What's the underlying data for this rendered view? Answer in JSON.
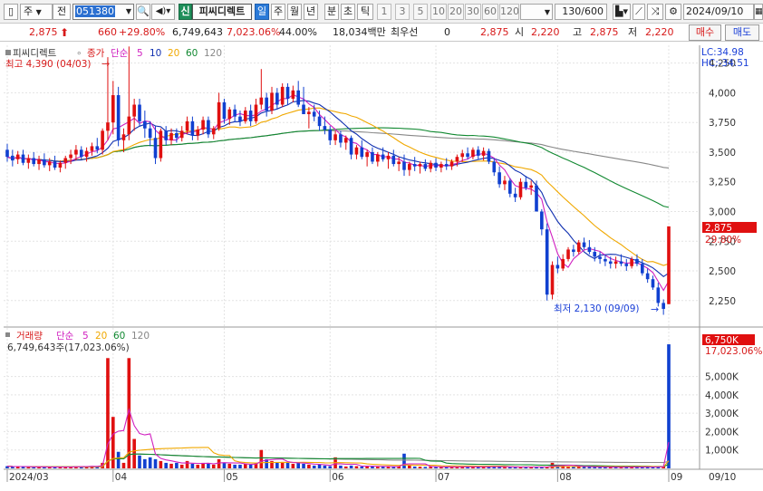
{
  "toolbar": {
    "market": "주",
    "jeon": "전",
    "code": "051380",
    "new_label": "신",
    "stock_name": "피씨디렉트",
    "periods": [
      "일",
      "주",
      "월",
      "년",
      "분",
      "초",
      "틱"
    ],
    "selected_period": "일",
    "intervals": [
      "1",
      "3",
      "5",
      "10",
      "20",
      "30",
      "60",
      "120"
    ],
    "count": "130/600",
    "date": "2024/09/10"
  },
  "quote": {
    "price": "2,875",
    "change": "660",
    "change_pct": "+29.80%",
    "volume": "6,749,643",
    "volume_ratio": "7,023.06%",
    "turnover": "44.00%",
    "amount": "18,034백만",
    "prefer_label": "최우선",
    "prefer_value": "0",
    "last": "2,875",
    "open_label": "시",
    "open": "2,220",
    "high_label": "고",
    "high": "2,875",
    "low_label": "저",
    "low": "2,220",
    "buy_label": "매수",
    "sell_label": "매도"
  },
  "price_panel": {
    "legend_name": "피씨디렉트",
    "legend_close": "종가",
    "legend_ma": "단순",
    "ma_periods": [
      "5",
      "10",
      "20",
      "60",
      "120"
    ],
    "lc_label": "LC:34.98",
    "hc_label": "HC:-34.51",
    "high_annotation": "최고 4,390 (04/03)",
    "low_annotation": "최저 2,130 (09/09)",
    "current_tag": "2,875",
    "pct_tag": "29.80%"
  },
  "volume_panel": {
    "legend_name": "거래량",
    "legend_ma": "단순",
    "ma_periods": [
      "5",
      "20",
      "60",
      "120"
    ],
    "volume_text": "6,749,643주(17,023.06%)",
    "current_tag": "6,750K",
    "pct_tag": "17,023.06%"
  },
  "colors": {
    "up": "#e01010",
    "down": "#1040d0",
    "ma5": "#d020c0",
    "ma10": "#1030b0",
    "ma20": "#f0a800",
    "ma60": "#108830",
    "ma120": "#888888"
  },
  "chart_data": [
    {
      "type": "candlestick",
      "ylim": [
        2050,
        4400
      ],
      "yticks": [
        2250,
        2500,
        2750,
        3000,
        3250,
        3500,
        3750,
        4000,
        4250
      ],
      "ytick_labels": [
        "2,250",
        "2,500",
        "2,750",
        "3,000",
        "3,250",
        "3,500",
        "3,750",
        "4,000",
        "4,250"
      ],
      "xlabels": [
        {
          "i": 0,
          "label": "2024/03"
        },
        {
          "i": 20,
          "label": "04"
        },
        {
          "i": 41,
          "label": "05"
        },
        {
          "i": 61,
          "label": "06"
        },
        {
          "i": 81,
          "label": "07"
        },
        {
          "i": 104,
          "label": "08"
        },
        {
          "i": 125,
          "label": "09"
        },
        {
          "i": 138,
          "label": "09/10"
        }
      ],
      "ohlc": [
        [
          3520,
          3570,
          3420,
          3460
        ],
        [
          3470,
          3520,
          3380,
          3430
        ],
        [
          3440,
          3510,
          3400,
          3480
        ],
        [
          3480,
          3520,
          3390,
          3410
        ],
        [
          3410,
          3480,
          3360,
          3450
        ],
        [
          3450,
          3500,
          3380,
          3400
        ],
        [
          3400,
          3470,
          3350,
          3440
        ],
        [
          3440,
          3490,
          3370,
          3390
        ],
        [
          3390,
          3450,
          3340,
          3420
        ],
        [
          3420,
          3470,
          3350,
          3370
        ],
        [
          3370,
          3430,
          3330,
          3410
        ],
        [
          3410,
          3470,
          3360,
          3450
        ],
        [
          3450,
          3520,
          3400,
          3480
        ],
        [
          3480,
          3560,
          3430,
          3520
        ],
        [
          3520,
          3550,
          3440,
          3460
        ],
        [
          3460,
          3540,
          3420,
          3510
        ],
        [
          3510,
          3580,
          3470,
          3550
        ],
        [
          3550,
          3620,
          3490,
          3520
        ],
        [
          3520,
          3700,
          3480,
          3680
        ],
        [
          3680,
          4300,
          3600,
          3750
        ],
        [
          3750,
          4100,
          3650,
          3980
        ],
        [
          3980,
          4050,
          3550,
          3600
        ],
        [
          3600,
          3700,
          3500,
          3650
        ],
        [
          3650,
          4390,
          3600,
          3800
        ],
        [
          3800,
          3950,
          3680,
          3900
        ],
        [
          3900,
          3950,
          3720,
          3760
        ],
        [
          3760,
          3850,
          3620,
          3700
        ],
        [
          3700,
          3760,
          3550,
          3620
        ],
        [
          3620,
          3720,
          3400,
          3450
        ],
        [
          3450,
          3700,
          3420,
          3680
        ],
        [
          3680,
          3720,
          3560,
          3600
        ],
        [
          3600,
          3700,
          3560,
          3660
        ],
        [
          3660,
          3700,
          3580,
          3620
        ],
        [
          3620,
          3720,
          3590,
          3680
        ],
        [
          3680,
          3800,
          3650,
          3760
        ],
        [
          3760,
          3800,
          3600,
          3640
        ],
        [
          3640,
          3720,
          3600,
          3690
        ],
        [
          3690,
          3800,
          3650,
          3770
        ],
        [
          3770,
          3800,
          3620,
          3650
        ],
        [
          3650,
          3720,
          3610,
          3700
        ],
        [
          3700,
          4000,
          3680,
          3920
        ],
        [
          3920,
          3950,
          3740,
          3780
        ],
        [
          3780,
          3880,
          3730,
          3860
        ],
        [
          3860,
          3900,
          3750,
          3800
        ],
        [
          3800,
          3850,
          3720,
          3760
        ],
        [
          3760,
          3880,
          3740,
          3850
        ],
        [
          3850,
          3900,
          3720,
          3760
        ],
        [
          3760,
          3950,
          3740,
          3900
        ],
        [
          3900,
          4200,
          3860,
          3960
        ],
        [
          3960,
          4000,
          3800,
          3850
        ],
        [
          3850,
          4050,
          3820,
          4000
        ],
        [
          4000,
          4040,
          3860,
          3900
        ],
        [
          3900,
          4080,
          3880,
          4050
        ],
        [
          4050,
          4080,
          3900,
          3950
        ],
        [
          3950,
          4060,
          3920,
          4020
        ],
        [
          4020,
          4100,
          3880,
          3900
        ],
        [
          3900,
          4050,
          3860,
          3820
        ],
        [
          3820,
          3880,
          3700,
          3840
        ],
        [
          3840,
          3900,
          3760,
          3800
        ],
        [
          3800,
          3850,
          3680,
          3720
        ],
        [
          3720,
          3800,
          3650,
          3690
        ],
        [
          3690,
          3720,
          3560,
          3600
        ],
        [
          3600,
          3680,
          3560,
          3650
        ],
        [
          3650,
          3680,
          3540,
          3580
        ],
        [
          3580,
          3640,
          3520,
          3620
        ],
        [
          3620,
          3640,
          3440,
          3480
        ],
        [
          3480,
          3560,
          3440,
          3540
        ],
        [
          3540,
          3600,
          3440,
          3460
        ],
        [
          3460,
          3520,
          3380,
          3500
        ],
        [
          3500,
          3540,
          3400,
          3420
        ],
        [
          3420,
          3500,
          3380,
          3480
        ],
        [
          3480,
          3540,
          3420,
          3440
        ],
        [
          3440,
          3500,
          3360,
          3470
        ],
        [
          3470,
          3520,
          3380,
          3400
        ],
        [
          3400,
          3460,
          3340,
          3420
        ],
        [
          3420,
          3480,
          3300,
          3350
        ],
        [
          3350,
          3420,
          3300,
          3400
        ],
        [
          3400,
          3460,
          3340,
          3380
        ],
        [
          3380,
          3420,
          3320,
          3400
        ],
        [
          3400,
          3440,
          3340,
          3360
        ],
        [
          3360,
          3430,
          3330,
          3410
        ],
        [
          3410,
          3450,
          3340,
          3370
        ],
        [
          3370,
          3420,
          3330,
          3400
        ],
        [
          3400,
          3450,
          3350,
          3380
        ],
        [
          3380,
          3440,
          3350,
          3420
        ],
        [
          3420,
          3480,
          3380,
          3460
        ],
        [
          3460,
          3520,
          3420,
          3490
        ],
        [
          3490,
          3540,
          3440,
          3460
        ],
        [
          3460,
          3540,
          3440,
          3520
        ],
        [
          3520,
          3550,
          3440,
          3470
        ],
        [
          3470,
          3540,
          3430,
          3510
        ],
        [
          3510,
          3530,
          3400,
          3420
        ],
        [
          3420,
          3450,
          3300,
          3330
        ],
        [
          3330,
          3380,
          3200,
          3230
        ],
        [
          3230,
          3300,
          3180,
          3260
        ],
        [
          3260,
          3280,
          3120,
          3150
        ],
        [
          3150,
          3200,
          3080,
          3120
        ],
        [
          3120,
          3280,
          3100,
          3250
        ],
        [
          3250,
          3300,
          3180,
          3200
        ],
        [
          3200,
          3260,
          3140,
          3220
        ],
        [
          3220,
          3260,
          3080,
          3000
        ],
        [
          3000,
          3020,
          2800,
          2850
        ],
        [
          2850,
          2900,
          2250,
          2300
        ],
        [
          2300,
          2580,
          2260,
          2550
        ],
        [
          2550,
          2620,
          2480,
          2520
        ],
        [
          2520,
          2640,
          2500,
          2600
        ],
        [
          2600,
          2700,
          2580,
          2680
        ],
        [
          2680,
          2720,
          2620,
          2660
        ],
        [
          2660,
          2760,
          2640,
          2740
        ],
        [
          2740,
          2780,
          2680,
          2700
        ],
        [
          2700,
          2760,
          2640,
          2660
        ],
        [
          2660,
          2700,
          2580,
          2620
        ],
        [
          2620,
          2660,
          2560,
          2600
        ],
        [
          2600,
          2640,
          2540,
          2580
        ],
        [
          2580,
          2620,
          2520,
          2560
        ],
        [
          2560,
          2620,
          2520,
          2580
        ],
        [
          2580,
          2640,
          2540,
          2560
        ],
        [
          2560,
          2600,
          2500,
          2540
        ],
        [
          2540,
          2620,
          2520,
          2600
        ],
        [
          2600,
          2640,
          2540,
          2560
        ],
        [
          2560,
          2600,
          2460,
          2480
        ],
        [
          2480,
          2520,
          2400,
          2430
        ],
        [
          2430,
          2460,
          2340,
          2360
        ],
        [
          2360,
          2400,
          2200,
          2230
        ],
        [
          2230,
          2260,
          2130,
          2180
        ],
        [
          2220,
          2875,
          2220,
          2875
        ]
      ]
    },
    {
      "type": "bar",
      "ylim": [
        0,
        7000000
      ],
      "yticks": [
        1000000,
        2000000,
        3000000,
        4000000,
        5000000
      ],
      "ytick_labels": [
        "1,000K",
        "2,000K",
        "3,000K",
        "4,000K",
        "5,000K"
      ],
      "values": [
        120000,
        90000,
        80000,
        110000,
        70000,
        60000,
        90000,
        80000,
        70000,
        60000,
        80000,
        70000,
        100000,
        120000,
        90000,
        110000,
        130000,
        100000,
        300000,
        6000000,
        2800000,
        900000,
        300000,
        6000000,
        1600000,
        700000,
        500000,
        600000,
        500000,
        400000,
        300000,
        250000,
        300000,
        200000,
        400000,
        250000,
        200000,
        300000,
        250000,
        200000,
        500000,
        300000,
        250000,
        200000,
        200000,
        250000,
        200000,
        300000,
        1000000,
        500000,
        400000,
        300000,
        350000,
        300000,
        250000,
        300000,
        250000,
        200000,
        150000,
        200000,
        150000,
        120000,
        600000,
        150000,
        100000,
        150000,
        120000,
        100000,
        130000,
        110000,
        90000,
        100000,
        80000,
        90000,
        100000,
        800000,
        150000,
        100000,
        90000,
        80000,
        90000,
        80000,
        70000,
        80000,
        90000,
        80000,
        90000,
        70000,
        80000,
        90000,
        80000,
        100000,
        90000,
        80000,
        70000,
        80000,
        70000,
        60000,
        90000,
        80000,
        60000,
        70000,
        80000,
        300000,
        200000,
        150000,
        120000,
        100000,
        90000,
        80000,
        70000,
        80000,
        70000,
        60000,
        70000,
        60000,
        70000,
        80000,
        70000,
        60000,
        70000,
        80000,
        90000,
        100000,
        120000,
        6749643
      ],
      "up": [
        false,
        false,
        true,
        false,
        true,
        false,
        true,
        false,
        true,
        false,
        true,
        true,
        true,
        true,
        false,
        true,
        true,
        false,
        true,
        true,
        true,
        false,
        true,
        true,
        true,
        false,
        false,
        false,
        false,
        true,
        false,
        true,
        false,
        true,
        true,
        false,
        true,
        true,
        false,
        true,
        true,
        false,
        true,
        false,
        false,
        true,
        false,
        true,
        true,
        false,
        true,
        false,
        true,
        false,
        true,
        false,
        false,
        true,
        false,
        false,
        false,
        false,
        true,
        false,
        true,
        false,
        true,
        false,
        true,
        false,
        true,
        false,
        true,
        false,
        true,
        false,
        true,
        false,
        true,
        false,
        true,
        false,
        true,
        false,
        true,
        true,
        true,
        false,
        true,
        false,
        true,
        false,
        false,
        false,
        true,
        false,
        false,
        true,
        false,
        true,
        false,
        false,
        true,
        true,
        false,
        true,
        true,
        false,
        true,
        false,
        false,
        false,
        false,
        false,
        true,
        false,
        true,
        false,
        true,
        false,
        false,
        false,
        false,
        false,
        true
      ]
    }
  ]
}
